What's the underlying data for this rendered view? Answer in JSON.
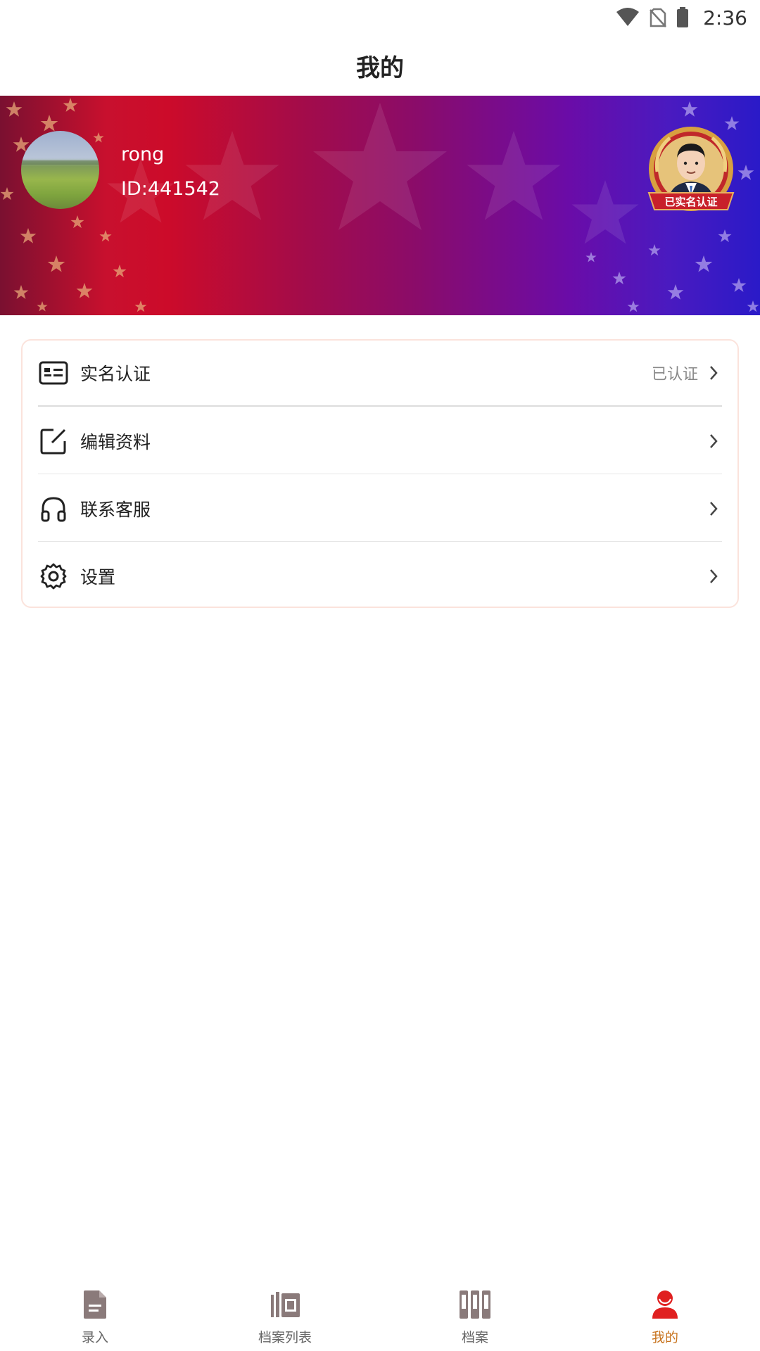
{
  "status_bar": {
    "time": "2:36"
  },
  "header": {
    "title": "我的"
  },
  "profile": {
    "username": "rong",
    "id": "ID:441542",
    "badge_text": "已实名认证"
  },
  "menu": {
    "items": [
      {
        "label": "实名认证",
        "status": "已认证",
        "icon": "id-card-icon"
      },
      {
        "label": "编辑资料",
        "status": "",
        "icon": "edit-icon"
      },
      {
        "label": "联系客服",
        "status": "",
        "icon": "headphones-icon"
      },
      {
        "label": "设置",
        "status": "",
        "icon": "gear-icon"
      }
    ]
  },
  "tabs": [
    {
      "label": "录入",
      "icon": "document-icon",
      "active": false
    },
    {
      "label": "档案列表",
      "icon": "archive-list-icon",
      "active": false
    },
    {
      "label": "档案",
      "icon": "archive-icon",
      "active": false
    },
    {
      "label": "我的",
      "icon": "person-icon",
      "active": true
    }
  ],
  "colors": {
    "active_tab": "#c8741f",
    "inactive_icon": "#8a7a7a",
    "card_border": "#fbe3dc",
    "banner_left": "#c8102e",
    "banner_right": "#2a1ac8"
  }
}
